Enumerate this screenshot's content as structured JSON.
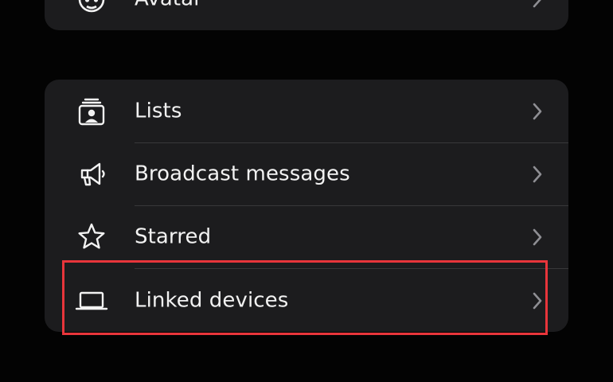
{
  "top_group": {
    "items": [
      {
        "label": "Avatar",
        "icon": "avatar-icon"
      }
    ]
  },
  "main_group": {
    "items": [
      {
        "label": "Lists",
        "icon": "lists-icon"
      },
      {
        "label": "Broadcast messages",
        "icon": "megaphone-icon"
      },
      {
        "label": "Starred",
        "icon": "star-icon"
      },
      {
        "label": "Linked devices",
        "icon": "laptop-icon"
      }
    ]
  },
  "highlight": {
    "target": "Linked devices",
    "color": "#e8353b"
  },
  "colors": {
    "background": "#030303",
    "group_background": "#1c1c1e",
    "text": "#f2f2f2",
    "chevron": "#8e8e93",
    "divider": "#38383a"
  }
}
